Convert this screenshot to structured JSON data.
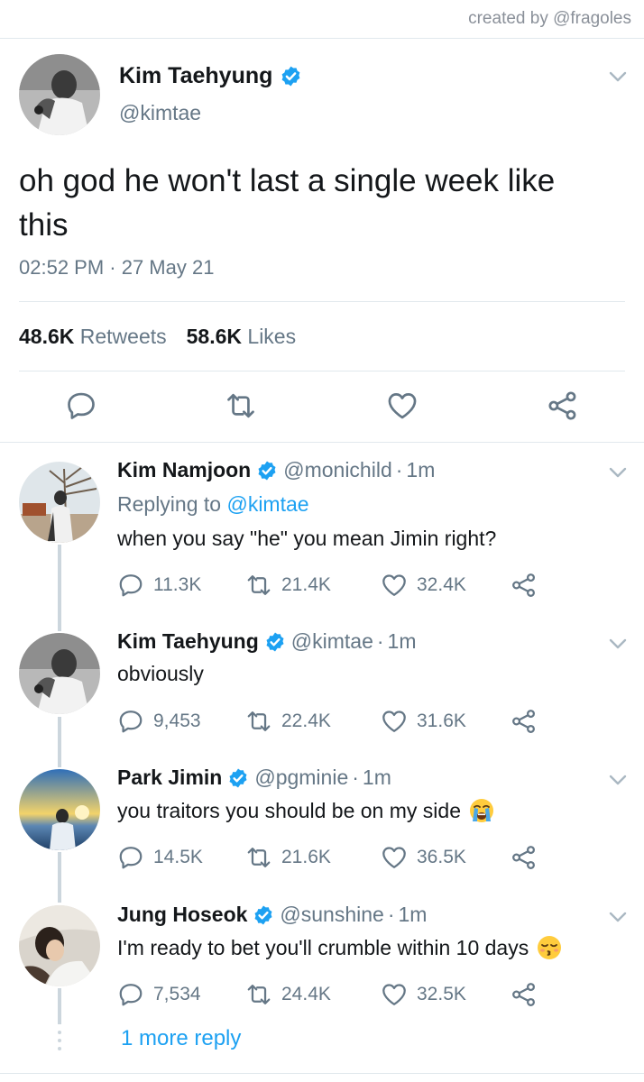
{
  "credit": "created by @fragoles",
  "main_tweet": {
    "name": "Kim Taehyung",
    "handle": "@kimtae",
    "text": "oh god he won't last a single week like this",
    "timestamp": "02:52 PM · 27 May 21",
    "retweets_count": "48.6K",
    "retweets_label": "Retweets",
    "likes_count": "58.6K",
    "likes_label": "Likes"
  },
  "replies": [
    {
      "name": "Kim Namjoon",
      "handle": "@monichild",
      "separator": "·",
      "time": "1m",
      "replying_label": "Replying to",
      "replying_handle": "@kimtae",
      "text": "when you say \"he\" you mean Jimin right?",
      "comments": "11.3K",
      "retweets": "21.4K",
      "likes": "32.4K"
    },
    {
      "name": "Kim Taehyung",
      "handle": "@kimtae",
      "separator": "·",
      "time": "1m",
      "text": "obviously",
      "comments": "9,453",
      "retweets": "22.4K",
      "likes": "31.6K"
    },
    {
      "name": "Park Jimin",
      "handle": "@pgminie",
      "separator": "·",
      "time": "1m",
      "text": "you traitors you should be on my side",
      "emoji": "loudly-crying-face",
      "comments": "14.5K",
      "retweets": "21.6K",
      "likes": "36.5K"
    },
    {
      "name": "Jung Hoseok",
      "handle": "@sunshine",
      "separator": "·",
      "time": "1m",
      "text": "I'm ready to bet you'll crumble within 10 days",
      "emoji": "kissing-face-with-closed-eyes",
      "comments": "7,534",
      "retweets": "24.4K",
      "likes": "32.5K"
    }
  ],
  "more_replies": "1 more reply",
  "colors": {
    "accent": "#1da1f2",
    "secondary_text": "#657786",
    "border": "#e1e8ed",
    "thread_line": "#ccd6dd"
  },
  "icons": {
    "verified": "verified-badge-icon",
    "reply": "reply-icon",
    "retweet": "retweet-icon",
    "like": "heart-icon",
    "share": "share-icon",
    "menu": "chevron-down-icon"
  }
}
